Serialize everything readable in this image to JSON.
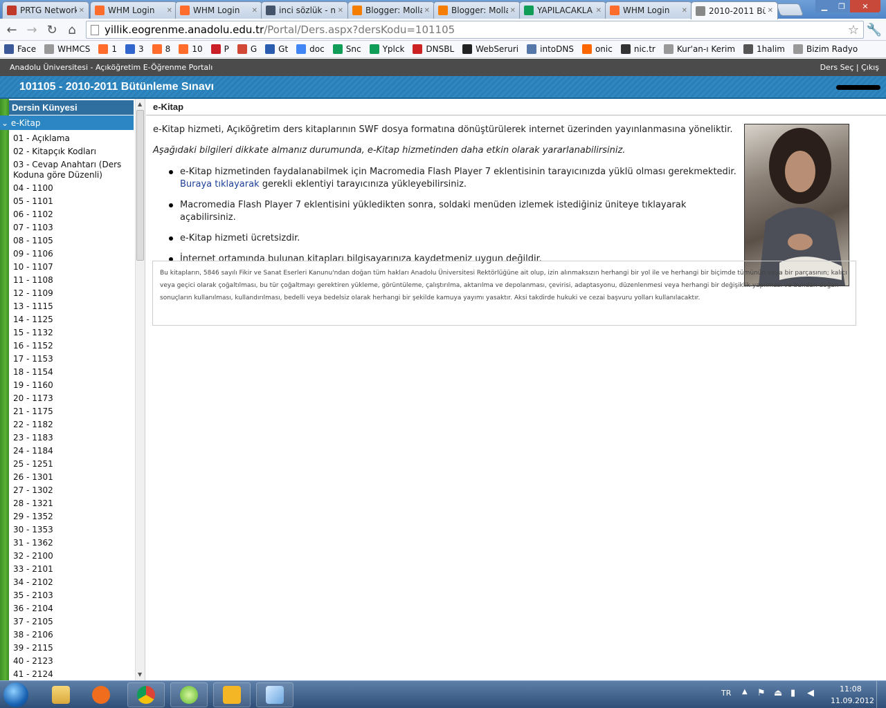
{
  "browser": {
    "tabs": [
      {
        "title": "PRTG Network",
        "icon": "prtg-icon",
        "color": "#c0392b"
      },
      {
        "title": "WHM Login",
        "icon": "cpanel-icon",
        "color": "#ff6c2c"
      },
      {
        "title": "WHM Login",
        "icon": "cpanel-icon",
        "color": "#ff6c2c"
      },
      {
        "title": "inci sözlük - n",
        "icon": "inci-icon",
        "color": "#44546a"
      },
      {
        "title": "Blogger: Molla",
        "icon": "blogger-icon",
        "color": "#f57d00"
      },
      {
        "title": "Blogger: Molla",
        "icon": "blogger-icon",
        "color": "#f57d00"
      },
      {
        "title": "YAPILACAKLA",
        "icon": "spreadsheet-icon",
        "color": "#0f9d58"
      },
      {
        "title": "WHM Login",
        "icon": "cpanel-icon",
        "color": "#ff6c2c"
      },
      {
        "title": "2010-2011 Büt",
        "icon": "page-icon",
        "color": "#888888"
      }
    ],
    "url_host": "yillik.eogrenme.anadolu.edu.tr",
    "url_path": "/Portal/Ders.aspx?dersKodu=101105",
    "bookmarks": [
      {
        "label": "Face",
        "icon": "facebook-icon",
        "color": "#3b5998"
      },
      {
        "label": "WHMCS",
        "icon": "page-icon",
        "color": "#999999"
      },
      {
        "label": "1",
        "icon": "cpanel-icon",
        "color": "#ff6c2c"
      },
      {
        "label": "3",
        "icon": "calendar-icon",
        "color": "#3366cc"
      },
      {
        "label": "8",
        "icon": "cpanel-icon",
        "color": "#ff6c2c"
      },
      {
        "label": "10",
        "icon": "cpanel-icon",
        "color": "#ff6c2c"
      },
      {
        "label": "P",
        "icon": "pinterest-icon",
        "color": "#cb2027"
      },
      {
        "label": "G",
        "icon": "gmail-icon",
        "color": "#d14836"
      },
      {
        "label": "Gt",
        "icon": "calendar30-icon",
        "color": "#2a5db0"
      },
      {
        "label": "doc",
        "icon": "docs-icon",
        "color": "#4285f4"
      },
      {
        "label": "Snc",
        "icon": "sheets-icon",
        "color": "#0f9d58"
      },
      {
        "label": "Yplck",
        "icon": "sheets-icon",
        "color": "#0f9d58"
      },
      {
        "label": "DNSBL",
        "icon": "ip-icon",
        "color": "#cc2222"
      },
      {
        "label": "WebSeruri",
        "icon": "s-icon",
        "color": "#222222"
      },
      {
        "label": "intoDNS",
        "icon": "dns-icon",
        "color": "#5577aa"
      },
      {
        "label": "onic",
        "icon": "onic-icon",
        "color": "#ff6600"
      },
      {
        "label": "nic.tr",
        "icon": "tr-icon",
        "color": "#333333"
      },
      {
        "label": "Kur'an-ı Kerim",
        "icon": "page-icon",
        "color": "#999999"
      },
      {
        "label": "1halim",
        "icon": "film-icon",
        "color": "#555555"
      },
      {
        "label": "Bizim Radyo",
        "icon": "page-icon",
        "color": "#999999"
      }
    ]
  },
  "portal": {
    "name": "Anadolu Üniversitesi - Açıköğretim E-Öğrenme Portalı",
    "ders_sec": "Ders Seç",
    "separator": "|",
    "cikis": "Çıkış",
    "course_title": "101105 - 2010-2011 Bütünleme Sınavı"
  },
  "sidebar": {
    "header": "Dersin Künyesi",
    "selected": "⌄ e-Kitap",
    "items": [
      "01 - Açıklama",
      "02 - Kitapçık Kodları",
      "03 - Cevap Anahtarı (Ders Koduna göre Düzenli)",
      "04 - 1100",
      "05 - 1101",
      "06 - 1102",
      "07 - 1103",
      "08 - 1105",
      "09 - 1106",
      "10 - 1107",
      "11 - 1108",
      "12 - 1109",
      "13 - 1115",
      "14 - 1125",
      "15 - 1132",
      "16 - 1152",
      "17 - 1153",
      "18 - 1154",
      "19 - 1160",
      "20 - 1173",
      "21 - 1175",
      "22 - 1182",
      "23 - 1183",
      "24 - 1184",
      "25 - 1251",
      "26 - 1301",
      "27 - 1302",
      "28 - 1321",
      "29 - 1352",
      "30 - 1353",
      "31 - 1362",
      "32 - 2100",
      "33 - 2101",
      "34 - 2102",
      "35 - 2103",
      "36 - 2104",
      "37 - 2105",
      "38 - 2106",
      "39 - 2115",
      "40 - 2123",
      "41 - 2124"
    ]
  },
  "content": {
    "heading": "e-Kitap",
    "intro": "e-Kitap hizmeti, Açıköğretim ders kitaplarının SWF dosya formatına dönüştürülerek internet üzerinden yayınlanmasına yöneliktir.",
    "note": "Aşağıdaki bilgileri dikkate almanız durumunda, e-Kitap hizmetinden daha etkin olarak yararlanabilirsiniz.",
    "bullet1": "e-Kitap hizmetinden faydalanabilmek için Macromedia Flash Player 7 eklentisinin tarayıcınızda yüklü olması gerekmektedir.",
    "bullet1_link": "Buraya tıklayarak",
    "bullet1_rest": " gerekli eklentiyi tarayıcınıza yükleyebilirsiniz.",
    "bullet2": "Macromedia Flash Player 7 eklentisini yükledikten sonra, soldaki menüden izlemek istediğiniz üniteye tıklayarak açabilirsiniz.",
    "bullet3": "e-Kitap hizmeti ücretsizdir.",
    "bullet4": "İnternet ortamında bulunan kitapları bilgisayarınıza kaydetmeniz uygun değildir.",
    "copyright": "Bu kitapların, 5846 sayılı Fikir ve Sanat Eserleri Kanunu'ndan doğan tüm hakları Anadolu Üniversitesi Rektörlüğüne ait olup, izin alınmaksızın herhangi bir yol ile ve herhangi bir biçimde tümünün veya bir parçasının; kalıcı veya geçici olarak çoğaltılması, bu tür çoğaltmayı gerektiren yükleme, görüntüleme, çalıştırılma, aktarılma ve depolanması, çevirisi, adaptasyonu, düzenlenmesi veya herhangi bir değişiklik yapılması ve bundan doğan sonuçların kullanılması, kullandırılması, bedelli veya bedelsiz olarak herhangi bir şekilde kamuya yayımı yasaktır. Aksi takdirde hukuki ve cezai başvuru yolları kullanılacaktır."
  },
  "taskbar": {
    "lang": "TR",
    "time": "11:08",
    "date": "11.09.2012"
  }
}
